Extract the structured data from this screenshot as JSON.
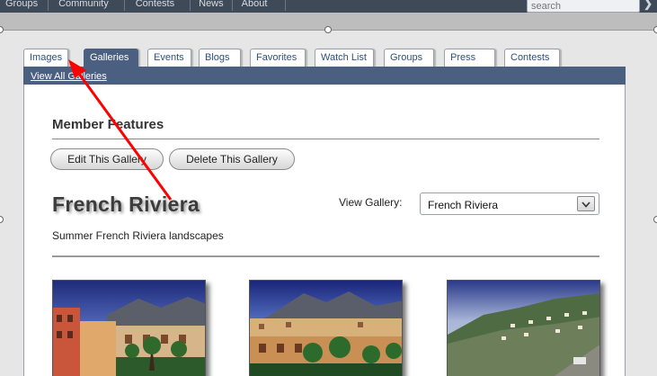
{
  "topnav": {
    "items": [
      "Groups",
      "Community",
      "Contests",
      "News",
      "About"
    ],
    "search_placeholder": "search"
  },
  "tabs": [
    {
      "label": "Images"
    },
    {
      "label": "Galleries"
    },
    {
      "label": "Events"
    },
    {
      "label": "Blogs"
    },
    {
      "label": "Favorites"
    },
    {
      "label": "Watch List"
    },
    {
      "label": "Groups"
    },
    {
      "label": "Press"
    },
    {
      "label": "Contests"
    }
  ],
  "subnav": {
    "link": "View All Galleries"
  },
  "member_features": {
    "title": "Member Features",
    "edit_button": "Edit This Gallery",
    "delete_button": "Delete This Gallery"
  },
  "gallery": {
    "title": "French Riviera",
    "description": "Summer French Riviera landscapes",
    "view_label": "View Gallery:",
    "selected": "French Riviera"
  },
  "icons": {
    "search_go": "chevron-right-icon",
    "select_arrow": "chevron-down-icon",
    "annotation": "red-arrow-icon"
  },
  "colors": {
    "tab_active": "#4b5f80",
    "top_bar": "#3e4a58",
    "annotation_arrow": "#ff0000"
  }
}
